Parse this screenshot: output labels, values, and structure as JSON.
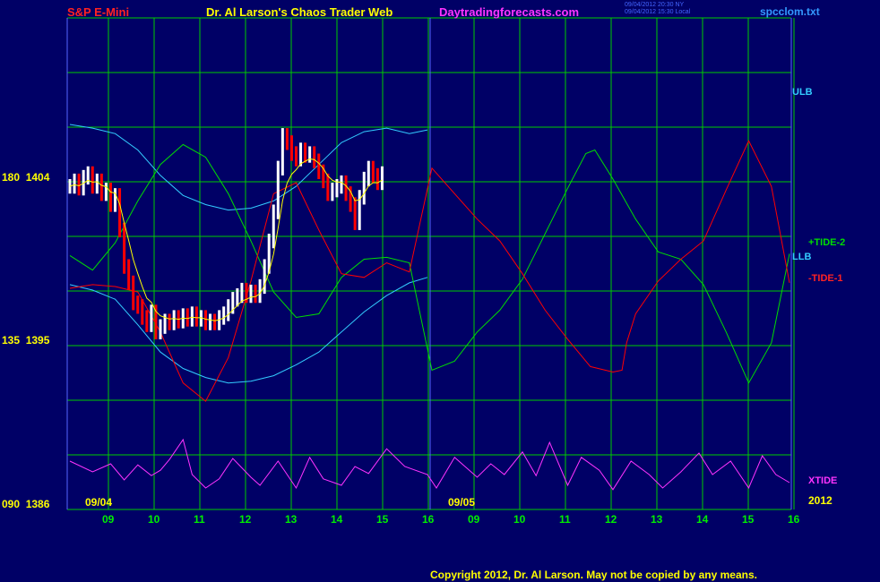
{
  "header": {
    "left": "S&P E-Mini",
    "center": "Dr. Al Larson's Chaos Trader Web",
    "site": "Daytradingforecasts.com",
    "stamp_line1": "09/04/2012 20:30 NY",
    "stamp_line2": "09/04/2012 15:30 Local",
    "file": "spcclom.txt"
  },
  "colors": {
    "background": "#000066",
    "grid": "#00cc00",
    "frame": "#5566ff",
    "price_up": "#ffffff",
    "price_down": "#ff0000",
    "moving_avg": "#ffff00",
    "band": "#33ccff",
    "tide_pos": "#00dd00",
    "tide_neg": "#ff0000",
    "xtide": "#ff33ff",
    "title_left": "#ff2222",
    "title_center": "#ffff00",
    "title_site": "#ff33ff",
    "file": "#3399ff"
  },
  "series_labels": {
    "ulb": "ULB",
    "lb": "LLB",
    "tide2": "+TIDE-2",
    "tide1": "-TIDE-1",
    "xtide": "XTIDE"
  },
  "y_labels": [
    {
      "text": "180  1404"
    },
    {
      "text": "135  1395"
    },
    {
      "text": "090  1386"
    }
  ],
  "date_labels": [
    {
      "text": "09/04"
    },
    {
      "text": "09/05"
    },
    {
      "text": "2012"
    }
  ],
  "x_ticks": [
    "09",
    "10",
    "11",
    "12",
    "13",
    "14",
    "15",
    "16",
    "09",
    "10",
    "11",
    "12",
    "13",
    "14",
    "15",
    "16"
  ],
  "copyright": "Copyright 2012, Dr. Al Larson. May not be copied by any means.",
  "chart_data": {
    "type": "line",
    "title": "S&P E-Mini",
    "x_axis": "hours of day, two sessions (09/04 and 09/05)",
    "hours": [
      "09",
      "10",
      "11",
      "12",
      "13",
      "14",
      "15",
      "16"
    ],
    "sessions": [
      "09/04",
      "09/05"
    ],
    "price_axis": {
      "labels": [
        1404,
        1395,
        1386
      ],
      "ylim": [
        1386,
        1404
      ]
    },
    "angle_axis": {
      "labels": [
        180,
        135,
        90
      ]
    },
    "grid": true,
    "series": [
      {
        "name": "ULB",
        "t": [
          0,
          0.5,
          1,
          1.5,
          2,
          2.5,
          3,
          3.5,
          4,
          4.5,
          5,
          5.5,
          6,
          6.5,
          7,
          7.5,
          7.9
        ],
        "v": [
          1407,
          1406.8,
          1406.5,
          1405.6,
          1404.2,
          1403.1,
          1402.6,
          1402.3,
          1402.4,
          1402.8,
          1403.6,
          1404.8,
          1406,
          1406.6,
          1406.8,
          1406.5,
          1406.7
        ]
      },
      {
        "name": "LLB",
        "t": [
          0,
          0.5,
          1,
          1.5,
          2,
          2.5,
          3,
          3.5,
          4,
          4.5,
          5,
          5.5,
          6,
          6.5,
          7,
          7.5,
          7.9
        ],
        "v": [
          1398.2,
          1397.9,
          1397.4,
          1396,
          1394.5,
          1393.6,
          1393.1,
          1392.8,
          1392.9,
          1393.2,
          1393.8,
          1394.5,
          1395.6,
          1396.7,
          1397.6,
          1398.3,
          1398.6
        ]
      },
      {
        "name": "+TIDE-2",
        "t": [
          0,
          0.5,
          1,
          1.5,
          2,
          2.5,
          3,
          3.5,
          4,
          4.5,
          5,
          5.5,
          6,
          6.5,
          7,
          7.5,
          8,
          8.5,
          9,
          9.5,
          10,
          10.5,
          11,
          11.4,
          11.6,
          12,
          12.5,
          13,
          13.5,
          14,
          14.5,
          15,
          15.5,
          15.9
        ],
        "v": [
          1399.8,
          1399,
          1400.5,
          1402.8,
          1404.8,
          1405.9,
          1405.2,
          1403.2,
          1400.6,
          1397.8,
          1396.4,
          1396.6,
          1398.6,
          1399.6,
          1399.7,
          1399.4,
          1393.5,
          1394,
          1395.6,
          1396.8,
          1398.5,
          1401,
          1403.5,
          1405.4,
          1405.6,
          1404,
          1401.8,
          1400,
          1399.6,
          1398.2,
          1395.6,
          1392.8,
          1395,
          1399.9
        ]
      },
      {
        "name": "-TIDE-1",
        "t": [
          0,
          0.5,
          1,
          1.5,
          2,
          2.5,
          3,
          3.5,
          4,
          4.5,
          5,
          5.5,
          6,
          6.5,
          7,
          7.5,
          8,
          8.5,
          9,
          9.5,
          10,
          10.5,
          11,
          11.5,
          12,
          12.2,
          12.3,
          12.5,
          13,
          13.5,
          14,
          14.5,
          15,
          15.5,
          15.9
        ],
        "v": [
          1398,
          1398.2,
          1398.1,
          1397.8,
          1395.6,
          1392.8,
          1391.8,
          1394.2,
          1398.4,
          1403.2,
          1403.8,
          1401.2,
          1398.8,
          1398.6,
          1399.4,
          1398.9,
          1404.6,
          1403.2,
          1401.8,
          1400.6,
          1398.8,
          1396.8,
          1395.2,
          1393.7,
          1393.4,
          1393.5,
          1395,
          1396.6,
          1398.4,
          1399.6,
          1400.6,
          1403.4,
          1406.1,
          1403.6,
          1398.3
        ]
      },
      {
        "name": "XTIDE",
        "t": [
          0,
          0.5,
          0.9,
          1.2,
          1.5,
          1.8,
          2,
          2.2,
          2.5,
          2.7,
          3,
          3.3,
          3.6,
          4,
          4.2,
          4.6,
          5,
          5.3,
          5.6,
          6,
          6.3,
          6.6,
          7,
          7.4,
          7.9,
          8.1,
          8.5,
          9,
          9.3,
          9.6,
          10,
          10.3,
          10.6,
          11,
          11.3,
          11.7,
          12,
          12.4,
          12.8,
          13.1,
          13.5,
          13.9,
          14.2,
          14.6,
          15,
          15.3,
          15.6,
          15.9
        ],
        "v": [
          0.55,
          0.35,
          0.5,
          0.2,
          0.48,
          0.28,
          0.38,
          0.58,
          0.95,
          0.3,
          0.05,
          0.22,
          0.6,
          0.25,
          0.1,
          0.55,
          0.05,
          0.62,
          0.22,
          0.1,
          0.45,
          0.32,
          0.78,
          0.45,
          0.3,
          0.05,
          0.62,
          0.25,
          0.5,
          0.3,
          0.72,
          0.28,
          0.9,
          0.1,
          0.62,
          0.38,
          0.02,
          0.55,
          0.3,
          0.05,
          0.35,
          0.7,
          0.3,
          0.55,
          0.05,
          0.65,
          0.3,
          0.15
        ]
      },
      {
        "name": "price",
        "session": "09/04",
        "points": [
          [
            0.0,
            1403.6
          ],
          [
            0.1,
            1403.9
          ],
          [
            0.2,
            1403.5
          ],
          [
            0.3,
            1404.1
          ],
          [
            0.4,
            1404.3
          ],
          [
            0.5,
            1403.6
          ],
          [
            0.6,
            1403.9
          ],
          [
            0.7,
            1403.2
          ],
          [
            0.8,
            1403.4
          ],
          [
            0.9,
            1402.6
          ],
          [
            1.0,
            1403.1
          ],
          [
            1.1,
            1401.2
          ],
          [
            1.2,
            1399.2
          ],
          [
            1.3,
            1398.3
          ],
          [
            1.4,
            1397.2
          ],
          [
            1.5,
            1397.0
          ],
          [
            1.6,
            1396.4
          ],
          [
            1.7,
            1396.0
          ],
          [
            1.8,
            1396.7
          ],
          [
            1.9,
            1395.6
          ],
          [
            2.0,
            1395.9
          ],
          [
            2.1,
            1396.2
          ],
          [
            2.2,
            1396.1
          ],
          [
            2.3,
            1396.4
          ],
          [
            2.4,
            1396.2
          ],
          [
            2.5,
            1396.5
          ],
          [
            2.6,
            1396.3
          ],
          [
            2.7,
            1396.6
          ],
          [
            2.8,
            1396.3
          ],
          [
            2.9,
            1396.4
          ],
          [
            3.0,
            1396.1
          ],
          [
            3.1,
            1396.2
          ],
          [
            3.2,
            1396.1
          ],
          [
            3.3,
            1396.4
          ],
          [
            3.4,
            1396.6
          ],
          [
            3.5,
            1397.0
          ],
          [
            3.6,
            1397.4
          ],
          [
            3.7,
            1397.6
          ],
          [
            3.8,
            1397.9
          ],
          [
            3.9,
            1397.6
          ],
          [
            4.0,
            1397.8
          ],
          [
            4.1,
            1397.6
          ],
          [
            4.2,
            1398.1
          ],
          [
            4.3,
            1399.2
          ],
          [
            4.4,
            1400.6
          ],
          [
            4.5,
            1402.2
          ],
          [
            4.6,
            1404.6
          ],
          [
            4.7,
            1406.4
          ],
          [
            4.8,
            1406.0
          ],
          [
            4.9,
            1405.4
          ],
          [
            5.0,
            1405.1
          ],
          [
            5.1,
            1405.6
          ],
          [
            5.2,
            1405.3
          ],
          [
            5.3,
            1405.4
          ],
          [
            5.4,
            1405.0
          ],
          [
            5.5,
            1404.4
          ],
          [
            5.6,
            1403.9
          ],
          [
            5.7,
            1403.2
          ],
          [
            5.8,
            1403.4
          ],
          [
            5.9,
            1403.6
          ],
          [
            6.0,
            1403.8
          ],
          [
            6.1,
            1403.2
          ],
          [
            6.2,
            1402.6
          ],
          [
            6.3,
            1401.6
          ],
          [
            6.4,
            1403.0
          ],
          [
            6.5,
            1404.0
          ],
          [
            6.6,
            1404.6
          ],
          [
            6.7,
            1404.2
          ],
          [
            6.8,
            1403.8
          ],
          [
            6.9,
            1404.3
          ]
        ]
      }
    ]
  }
}
